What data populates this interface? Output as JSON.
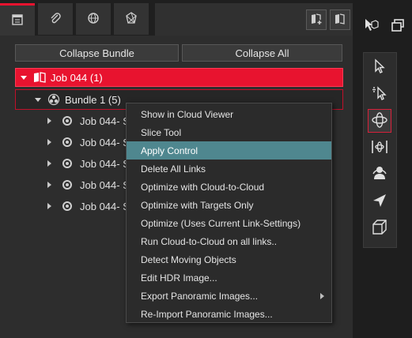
{
  "tabs": [
    {
      "icon": "document-list-icon",
      "active": true
    },
    {
      "icon": "paperclip-icon",
      "active": false
    },
    {
      "icon": "globe-icon",
      "active": false
    },
    {
      "icon": "polygon-star-icon",
      "active": false
    }
  ],
  "header_buttons": [
    "add-job-icon",
    "import-job-icon"
  ],
  "buttons": {
    "collapse_bundle": "Collapse Bundle",
    "collapse_all": "Collapse All"
  },
  "tree": {
    "job": "Job 044 (1)",
    "bundle": "Bundle 1 (5)",
    "children": [
      "Job 044- S",
      "Job 044- S",
      "Job 044- S",
      "Job 044- S",
      "Job 044- S"
    ]
  },
  "context_menu": {
    "items": [
      {
        "label": "Show in Cloud Viewer"
      },
      {
        "label": "Slice Tool"
      },
      {
        "label": "Apply Control",
        "highlighted": true
      },
      {
        "label": "Delete All Links"
      },
      {
        "label": "Optimize with Cloud-to-Cloud"
      },
      {
        "label": "Optimize with Targets Only"
      },
      {
        "label": "Optimize (Uses Current Link-Settings)"
      },
      {
        "label": "Run Cloud-to-Cloud on all links.."
      },
      {
        "label": "Detect Moving Objects"
      },
      {
        "label": "Edit HDR Image..."
      },
      {
        "label": "Export Panoramic Images...",
        "submenu": true
      },
      {
        "label": "Re-Import Panoramic Images..."
      }
    ]
  },
  "tools": [
    "cursor-arrow-icon",
    "select-arrow-icon",
    "orbit-icon",
    "fit-width-icon",
    "person-view-icon",
    "send-arrow-icon",
    "cube-icon"
  ],
  "colors": {
    "accent_red": "#e8132f",
    "menu_highlight": "#4f878f"
  }
}
